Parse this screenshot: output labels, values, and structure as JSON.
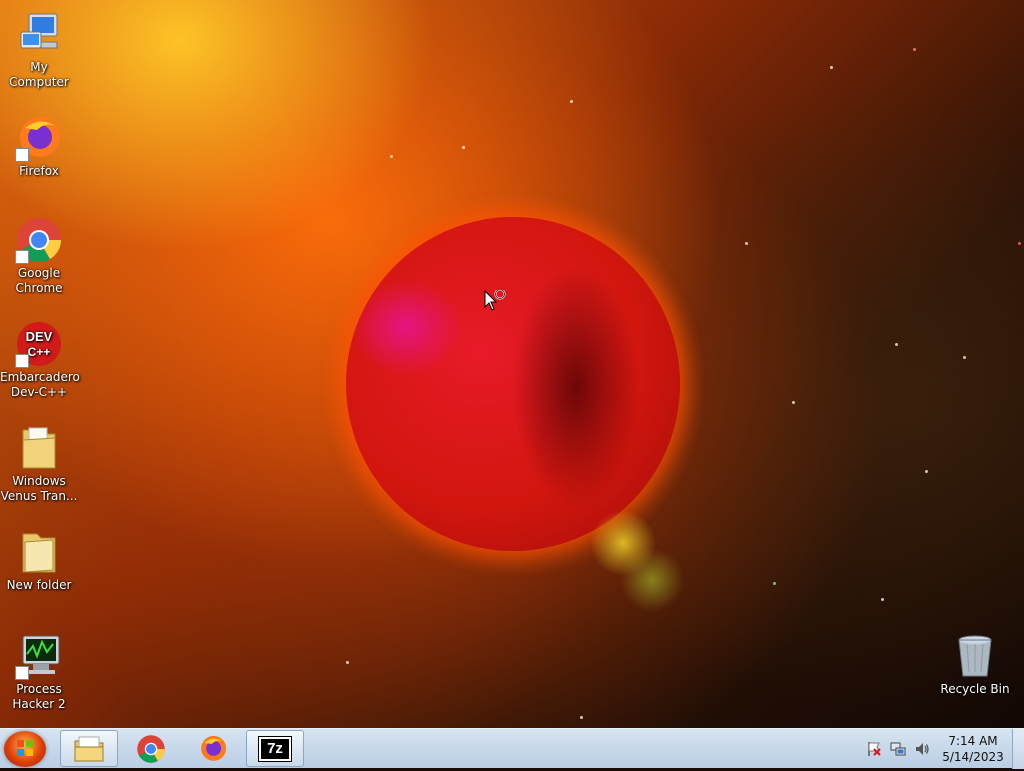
{
  "desktop_icons": [
    {
      "name": "my-computer",
      "label": "My Computer",
      "icon": "computer-icon"
    },
    {
      "name": "firefox",
      "label": "Firefox",
      "icon": "firefox-icon"
    },
    {
      "name": "google-chrome",
      "label": "Google Chrome",
      "icon": "chrome-icon"
    },
    {
      "name": "dev-cpp",
      "label": "Embarcadero Dev-C++",
      "icon": "devcpp-icon",
      "icon_text": "DEV C++"
    },
    {
      "name": "windows-venus-tran",
      "label": "Windows Venus Tran...",
      "icon": "folder-icon"
    },
    {
      "name": "new-folder",
      "label": "New folder",
      "icon": "folder-icon"
    },
    {
      "name": "process-hacker",
      "label": "Process Hacker 2",
      "icon": "process-hacker-icon"
    },
    {
      "name": "recycle-bin",
      "label": "Recycle Bin",
      "icon": "recycle-bin-icon"
    }
  ],
  "taskbar": {
    "start_icon": "windows-start-orb",
    "pinned": [
      {
        "name": "explorer",
        "icon": "explorer-icon",
        "active": true
      },
      {
        "name": "chrome",
        "icon": "chrome-icon",
        "active": false
      },
      {
        "name": "firefox",
        "icon": "firefox-icon",
        "active": false
      },
      {
        "name": "7zip",
        "icon": "7zip-icon",
        "icon_text": "7z",
        "active": true
      }
    ],
    "tray": {
      "icons": [
        "action-center-flag-icon",
        "network-icon",
        "volume-icon"
      ],
      "time": "7:14 AM",
      "date": "5/14/2023"
    }
  },
  "colors": {
    "taskbar_top": "#d7e4f1",
    "taskbar_bottom": "#b9cde3",
    "planet": "#d2160e",
    "nebula": "#ff8c14"
  }
}
